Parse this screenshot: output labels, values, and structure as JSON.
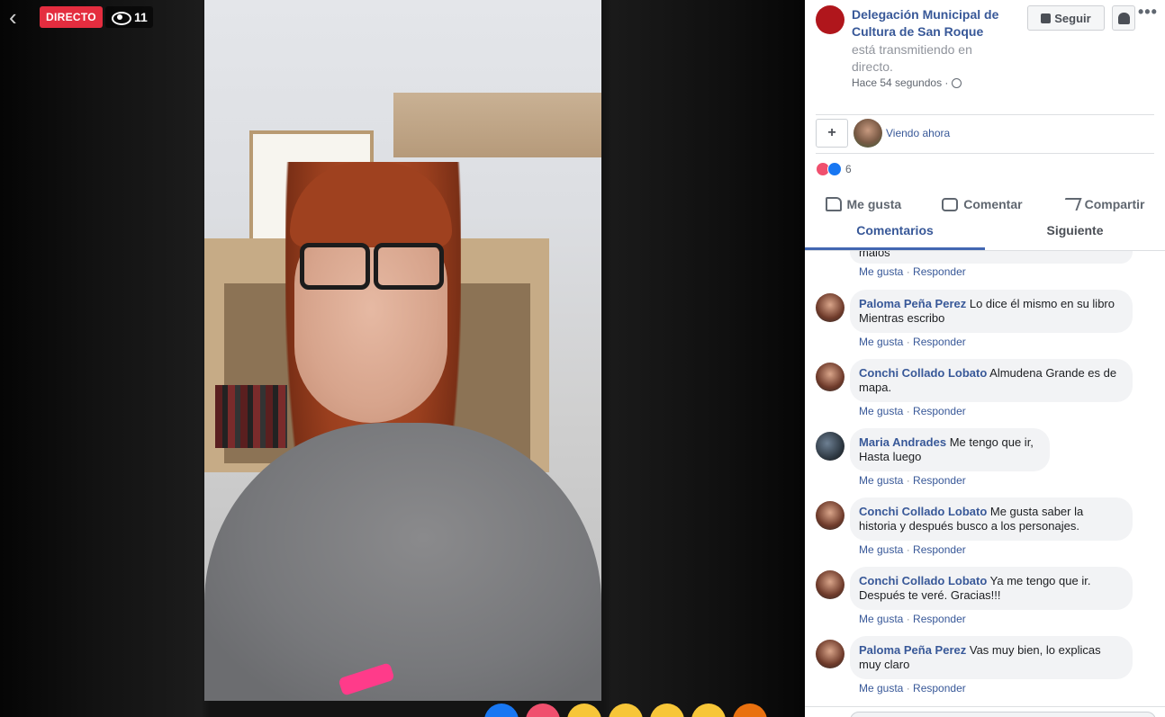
{
  "video": {
    "live_label": "DIRECTO",
    "viewer_count": "11"
  },
  "sidebar": {
    "page_name": "Delegación Municipal de Cultura de San Roque",
    "status": "está transmitiendo en directo.",
    "time": "Hace 54 segundos · ",
    "follow_label": "Seguir",
    "more_label": "•••",
    "viewing_now": "Viendo ahora",
    "reaction_count": "6",
    "actions": {
      "like": "Me gusta",
      "comment": "Comentar",
      "share": "Compartir"
    },
    "tabs": {
      "comments": "Comentarios",
      "next": "Siguiente"
    }
  },
  "comments": {
    "truncated_text": "malos",
    "like_label": "Me gusta",
    "reply_label": "Responder",
    "dot": "·",
    "items": [
      {
        "author": "Paloma Peña Perez",
        "text": "Lo dice él mismo en su libro Mientras escribo"
      },
      {
        "author": "Conchi Collado Lobato",
        "text": "Almudena Grande es de mapa."
      },
      {
        "author": "Maria Andrades",
        "text": "Me tengo que ir, Hasta luego"
      },
      {
        "author": "Conchi Collado Lobato",
        "text": "Me gusta saber la historia y después busco a los personajes."
      },
      {
        "author": "Conchi Collado Lobato",
        "text": "Ya me tengo que ir. Después te veré. Gracias!!!"
      },
      {
        "author": "Paloma Peña Perez",
        "text": "Vas muy bien, lo explicas muy claro"
      }
    ]
  }
}
